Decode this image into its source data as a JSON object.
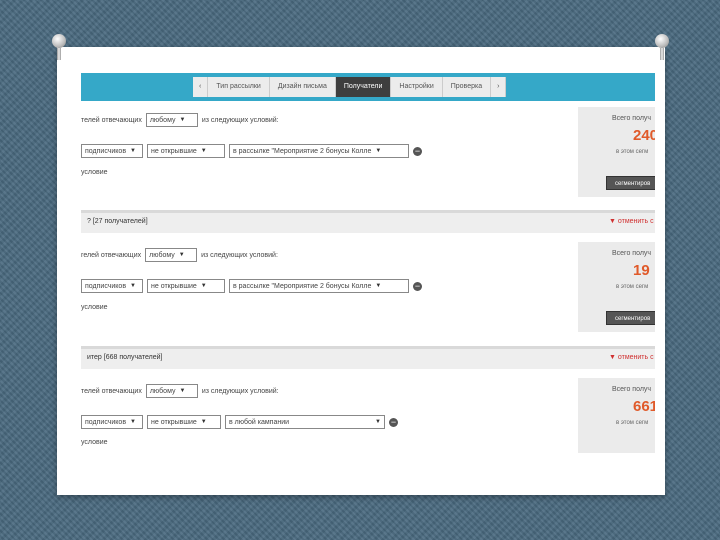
{
  "nav": {
    "tab_prev": "‹",
    "tabs": [
      "Тип рассылки",
      "Дизайн письма",
      "Получатели",
      "Настройки",
      "Проверка"
    ],
    "tab_next": "›",
    "active_index": 2
  },
  "blocks": [
    {
      "header": null,
      "rule_prefix": "телей отвечающих",
      "match_select": "любому",
      "rule_suffix": "из следующих условий:",
      "cond_field": "подписчиков",
      "cond_op": "не открывшие",
      "cond_value": "в рассылке \"Мероприятие 2 бонусы Колле",
      "add_condition": "условие",
      "side_label": "Всего получ",
      "side_count": "240",
      "side_sub": "в этом сегм",
      "side_button": "сегментиров"
    },
    {
      "header": "? [27 получателей]",
      "cancel": "▼ отменить с",
      "rule_prefix": "гелей отвечающих",
      "match_select": "любому",
      "rule_suffix": "из следующих условий:",
      "cond_field": "подписчиков",
      "cond_op": "не открывшие",
      "cond_value": "в рассылке \"Мероприятие 2 бонусы Колле",
      "add_condition": "условие",
      "side_label": "Всего получ",
      "side_count": "19",
      "side_sub": "в этом сегм",
      "side_button": "сегментиров"
    },
    {
      "header": "итер [668 получателей]",
      "cancel": "▼ отменить с",
      "rule_prefix": "телей отвечающих",
      "match_select": "любому",
      "rule_suffix": "из следующих условий:",
      "cond_field": "подписчиков",
      "cond_op": "не открывшие",
      "cond_value": "в любой кампании",
      "add_condition": "условие",
      "side_label": "Всего получ",
      "side_count": "661",
      "side_sub": "в этом сегм",
      "side_button": "сегментиров"
    }
  ],
  "colors": {
    "topbar": "#35a8c8",
    "active_tab": "#3e3e3e",
    "count": "#e05a2a",
    "cancel": "#d03030"
  }
}
